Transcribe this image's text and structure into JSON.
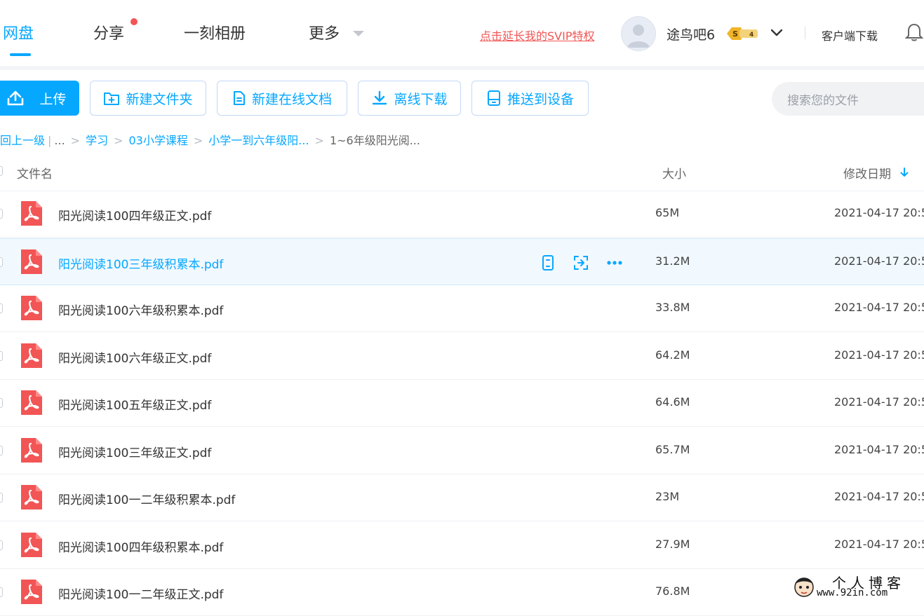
{
  "colors": {
    "accent": "#06a7ff",
    "danger": "#f25555",
    "pdf": "#f25555",
    "hover_row": "#f1f9ff"
  },
  "nav": {
    "items": [
      {
        "label": "网盘"
      },
      {
        "label": "分享"
      },
      {
        "label": "一刻相册"
      },
      {
        "label": "更多"
      }
    ],
    "active_index": 0
  },
  "header": {
    "svip_link": "点击延长我的SVIP特权",
    "username": "途鸟吧6",
    "vip_badge": {
      "letter": "S",
      "level": "4"
    },
    "client_download": "客户端下载",
    "icons": {
      "avatar": "avatar",
      "chevron": "chevron-down-icon",
      "bell": "bell-icon"
    }
  },
  "toolbar": {
    "upload": "上传",
    "new_folder": "新建文件夹",
    "new_online_doc": "新建在线文档",
    "offline_download": "离线下载",
    "push_to_device": "推送到设备",
    "search_placeholder": "搜索您的文件"
  },
  "breadcrumb": {
    "back": "回上一级",
    "ellipsis": "...",
    "items": [
      "学习",
      "03小学课程",
      "小学一到六年级阳...",
      "1~6年级阳光阅..."
    ]
  },
  "table": {
    "headers": {
      "name": "文件名",
      "size": "大小",
      "modified": "修改日期"
    },
    "sort": "modified-desc",
    "rows": [
      {
        "name": "阳光阅读100四年级正文.pdf",
        "size": "65M",
        "date": "2021-04-17 20:5"
      },
      {
        "name": "阳光阅读100三年级积累本.pdf",
        "size": "31.2M",
        "date": "2021-04-17 20:5"
      },
      {
        "name": "阳光阅读100六年级积累本.pdf",
        "size": "33.8M",
        "date": "2021-04-17 20:5"
      },
      {
        "name": "阳光阅读100六年级正文.pdf",
        "size": "64.2M",
        "date": "2021-04-17 20:5"
      },
      {
        "name": "阳光阅读100五年级正文.pdf",
        "size": "64.6M",
        "date": "2021-04-17 20:5"
      },
      {
        "name": "阳光阅读100三年级正文.pdf",
        "size": "65.7M",
        "date": "2021-04-17 20:5"
      },
      {
        "name": "阳光阅读100一二年级积累本.pdf",
        "size": "23M",
        "date": "2021-04-17 20:5"
      },
      {
        "name": "阳光阅读100四年级积累本.pdf",
        "size": "27.9M",
        "date": "2021-04-17 20:5"
      },
      {
        "name": "阳光阅读100一二年级正文.pdf",
        "size": "76.8M",
        "date": "2021-04-17 20:5"
      }
    ],
    "hovered_row": 1,
    "row_actions": [
      "phone-icon",
      "share-icon",
      "more-icon"
    ]
  },
  "watermark": {
    "title": "个人博客",
    "url": "www.92in.com"
  }
}
